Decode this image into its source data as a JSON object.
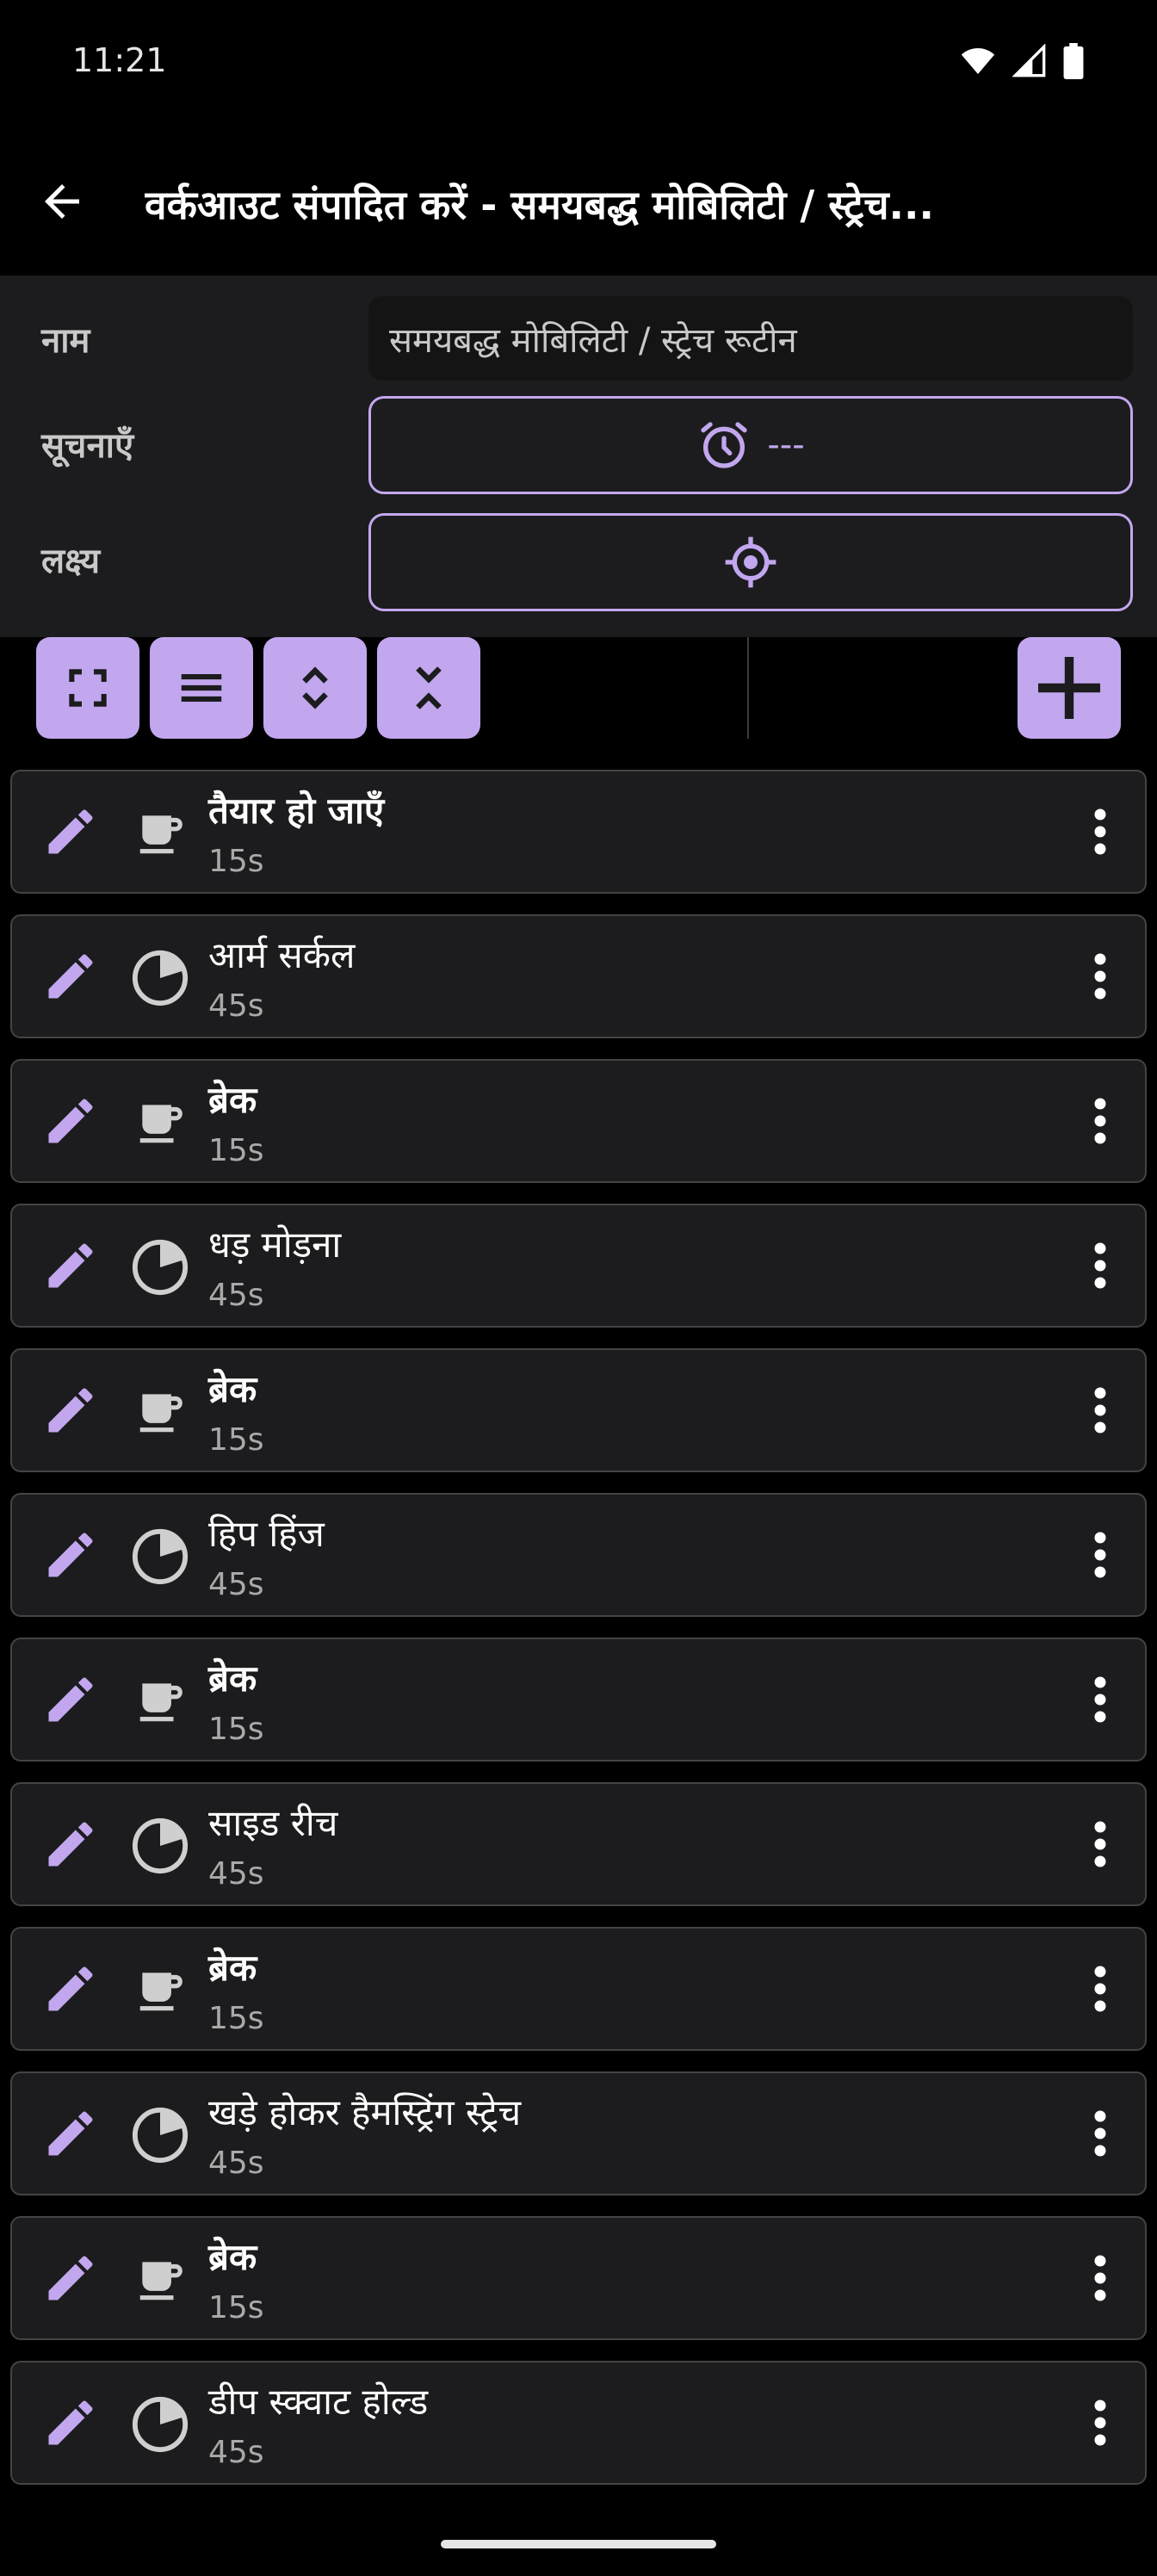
{
  "status": {
    "time": "11:21"
  },
  "app_bar": {
    "title": "वर्कआउट संपादित करें - समयबद्ध मोबिलिटी / स्ट्रेच..."
  },
  "form": {
    "name_label": "नाम",
    "name_value": "समयबद्ध मोबिलिटी / स्ट्रेच रूटीन",
    "notifications_label": "सूचनाएँ",
    "notifications_value": "---",
    "target_label": "लक्ष्य"
  },
  "colors": {
    "accent": "#c2a7ef",
    "panel": "#1c1c1e",
    "background": "#000000"
  },
  "toolbar": {
    "buttons": [
      "fullscreen-icon",
      "list-icon",
      "expand-icon",
      "collapse-icon"
    ],
    "add": "plus-icon"
  },
  "items": [
    {
      "title": "तैयार हो जाएँ",
      "duration": "15s",
      "type": "break"
    },
    {
      "title": "आर्म सर्कल",
      "duration": "45s",
      "type": "exercise"
    },
    {
      "title": "ब्रेक",
      "duration": "15s",
      "type": "break"
    },
    {
      "title": "धड़ मोड़ना",
      "duration": "45s",
      "type": "exercise"
    },
    {
      "title": "ब्रेक",
      "duration": "15s",
      "type": "break"
    },
    {
      "title": "हिप हिंज",
      "duration": "45s",
      "type": "exercise"
    },
    {
      "title": "ब्रेक",
      "duration": "15s",
      "type": "break"
    },
    {
      "title": "साइड रीच",
      "duration": "45s",
      "type": "exercise"
    },
    {
      "title": "ब्रेक",
      "duration": "15s",
      "type": "break"
    },
    {
      "title": "खड़े होकर हैमस्ट्रिंग स्ट्रेच",
      "duration": "45s",
      "type": "exercise"
    },
    {
      "title": "ब्रेक",
      "duration": "15s",
      "type": "break"
    },
    {
      "title": "डीप स्क्वाट होल्ड",
      "duration": "45s",
      "type": "exercise"
    }
  ]
}
